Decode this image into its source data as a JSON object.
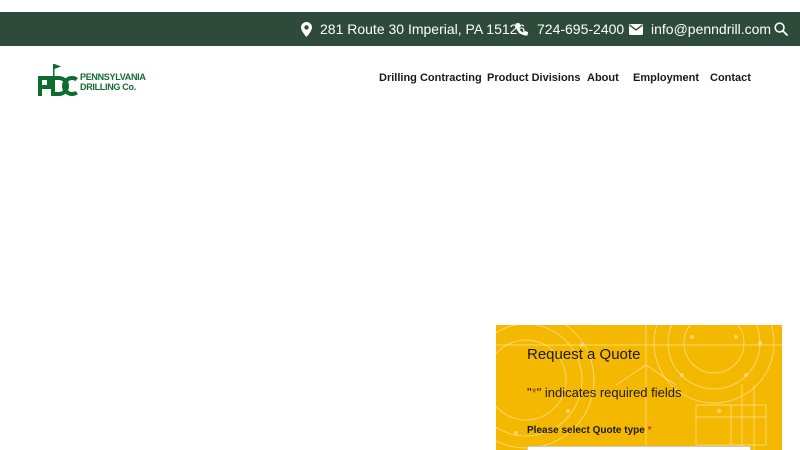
{
  "topbar": {
    "address": "281 Route 30 Imperial, PA 15126",
    "phone": "724-695-2400",
    "email": "info@penndrill.com",
    "icons": [
      "map-pin-icon",
      "phone-icon",
      "envelope-icon",
      "search-icon"
    ]
  },
  "logo": {
    "mark": "PDC",
    "line1": "PENNSYLVANIA",
    "line2": "DRILLING Co."
  },
  "nav": {
    "items": [
      {
        "label": "Drilling Contracting"
      },
      {
        "label": "Product Divisions"
      },
      {
        "label": "About"
      },
      {
        "label": "Employment"
      },
      {
        "label": "Contact"
      }
    ]
  },
  "quote_form": {
    "title": "Request a Quote",
    "required_note_prefix": "\"",
    "required_note_star": "*",
    "required_note_suffix": "\" indicates required fields",
    "field_label": "Please select Quote type",
    "field_required_star": "*",
    "field_value": ""
  },
  "colors": {
    "topbar_bg": "#2d4a3a",
    "brand_green": "#0f6b2e",
    "quote_bg": "#f5b800"
  }
}
